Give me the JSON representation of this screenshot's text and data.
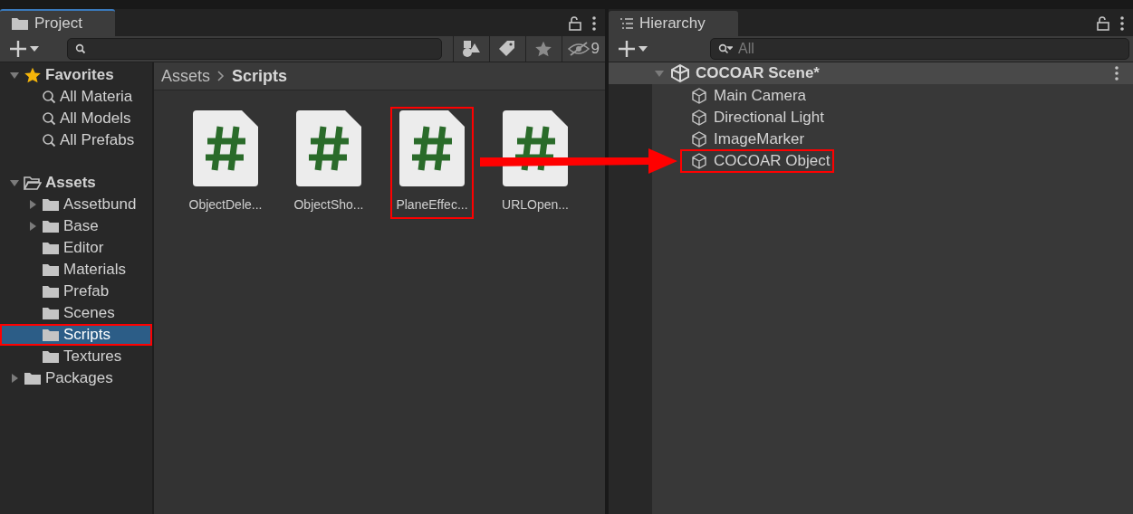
{
  "project": {
    "tab": "Project",
    "hidden_count": "9",
    "breadcrumb": [
      "Assets",
      "Scripts"
    ],
    "tree": [
      {
        "label": "Favorites",
        "kind": "favorites",
        "expanded": true,
        "selected": false,
        "highlighted": false,
        "children": [
          {
            "label": "All Materia",
            "kind": "search",
            "selected": false,
            "highlighted": false
          },
          {
            "label": "All Models",
            "kind": "search",
            "selected": false,
            "highlighted": false
          },
          {
            "label": "All Prefabs",
            "kind": "search",
            "selected": false,
            "highlighted": false
          }
        ]
      },
      {
        "label": "Assets",
        "kind": "open-folder",
        "expanded": true,
        "selected": false,
        "highlighted": false,
        "children": [
          {
            "label": "Assetbund",
            "kind": "folder",
            "expanded": false,
            "selected": false,
            "highlighted": false
          },
          {
            "label": "Base",
            "kind": "folder",
            "expanded": false,
            "selected": false,
            "highlighted": false
          },
          {
            "label": "Editor",
            "kind": "folder",
            "selected": false,
            "highlighted": false
          },
          {
            "label": "Materials",
            "kind": "folder",
            "selected": false,
            "highlighted": false
          },
          {
            "label": "Prefab",
            "kind": "folder",
            "selected": false,
            "highlighted": false
          },
          {
            "label": "Scenes",
            "kind": "folder",
            "selected": false,
            "highlighted": false
          },
          {
            "label": "Scripts",
            "kind": "folder",
            "selected": true,
            "highlighted": true
          },
          {
            "label": "Textures",
            "kind": "folder",
            "selected": false,
            "highlighted": false
          }
        ]
      },
      {
        "label": "Packages",
        "kind": "folder",
        "expanded": false,
        "selected": false,
        "highlighted": false
      }
    ],
    "assets": [
      {
        "name": "ObjectDele...",
        "highlighted": false
      },
      {
        "name": "ObjectSho...",
        "highlighted": false
      },
      {
        "name": "PlaneEffec...",
        "highlighted": true
      },
      {
        "name": "URLOpen...",
        "highlighted": false
      }
    ]
  },
  "hierarchy": {
    "tab": "Hierarchy",
    "search": {
      "placeholder": "All"
    },
    "scene": {
      "label": "COCOAR Scene*",
      "expanded": true,
      "children": [
        {
          "label": "Main Camera",
          "highlighted": false
        },
        {
          "label": "Directional Light",
          "highlighted": false
        },
        {
          "label": "ImageMarker",
          "highlighted": false
        },
        {
          "label": "COCOAR Object",
          "highlighted": true
        }
      ]
    }
  }
}
